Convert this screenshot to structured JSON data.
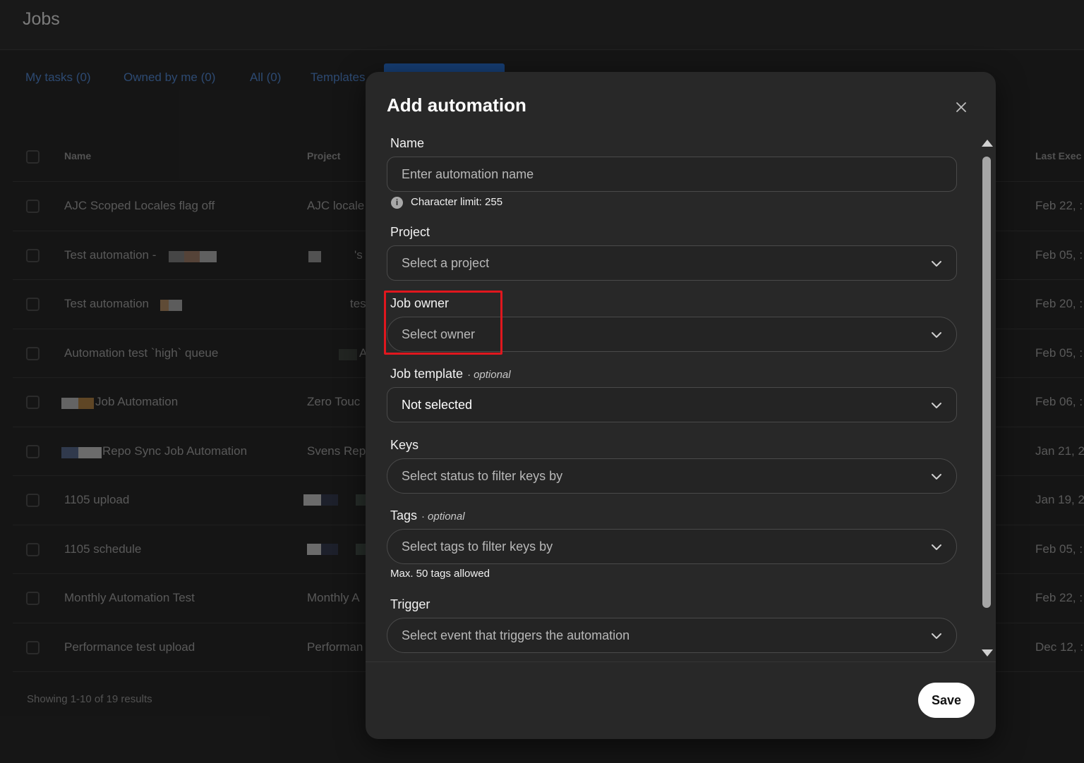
{
  "header": {
    "title": "Jobs"
  },
  "tabs": [
    {
      "label": "My tasks (0)"
    },
    {
      "label": "Owned by me (0)"
    },
    {
      "label": "All (0)"
    },
    {
      "label": "Templates"
    }
  ],
  "table": {
    "columns": {
      "name": "Name",
      "project": "Project",
      "last_executed": "Last Exec"
    },
    "rows": [
      {
        "name": "AJC Scoped Locales flag off",
        "project": "AJC locale",
        "last": "Feb 22, :"
      },
      {
        "name": "Test automation -",
        "project": "'s",
        "last": "Feb 05, :"
      },
      {
        "name": "Test automation",
        "project": "tes",
        "last": "Feb 20, :"
      },
      {
        "name": "Automation test `high` queue",
        "project": "A",
        "last": "Feb 05, :"
      },
      {
        "name": "Job Automation",
        "project": "Zero Touc",
        "last": "Feb 06, :"
      },
      {
        "name": "Repo Sync Job Automation",
        "project": "Svens Rep",
        "last": "Jan 21, 2"
      },
      {
        "name": "1105 upload",
        "project": "",
        "last": "Jan 19, 2"
      },
      {
        "name": "1105 schedule",
        "project": "",
        "last": "Feb 05, :"
      },
      {
        "name": "Monthly Automation Test",
        "project": "Monthly A",
        "last": "Feb 22, :"
      },
      {
        "name": "Performance test upload",
        "project": "Performan",
        "last": "Dec 12, :"
      }
    ]
  },
  "pagination": {
    "text": "Showing 1-10 of 19 results"
  },
  "modal": {
    "title": "Add automation",
    "close_icon": "close-icon",
    "fields": {
      "name": {
        "label": "Name",
        "placeholder": "Enter automation name",
        "hint": "Character limit: 255"
      },
      "project": {
        "label": "Project",
        "placeholder": "Select a project"
      },
      "job_owner": {
        "label": "Job owner",
        "placeholder": "Select owner"
      },
      "job_template": {
        "label": "Job template",
        "optional": "optional",
        "value": "Not selected"
      },
      "keys": {
        "label": "Keys",
        "placeholder": "Select status to filter keys by"
      },
      "tags": {
        "label": "Tags",
        "optional": "optional",
        "placeholder": "Select tags to filter keys by",
        "hint": "Max. 50 tags allowed"
      },
      "trigger": {
        "label": "Trigger",
        "placeholder": "Select event that triggers the automation"
      }
    },
    "save_label": "Save"
  },
  "colors": {
    "highlight": "#e0171e",
    "tab_link": "#3a5f93",
    "tab_active": "#1d4f92"
  }
}
